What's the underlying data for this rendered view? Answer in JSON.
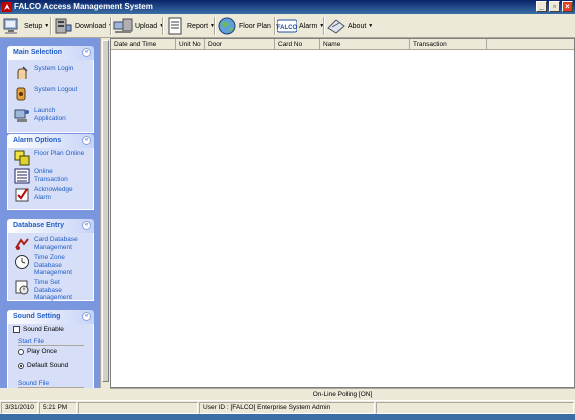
{
  "window": {
    "title": "FALCO  Access Management System"
  },
  "toolbar": {
    "items": [
      {
        "label": "Setup",
        "icon": "computer-icon"
      },
      {
        "label": "Download",
        "icon": "server-icon"
      },
      {
        "label": "Upload",
        "icon": "computers-icon"
      },
      {
        "label": "Report",
        "icon": "report-icon"
      },
      {
        "label": "Floor Plan",
        "icon": "globe-icon"
      },
      {
        "label": "Alarm",
        "icon": "falco-logo-icon",
        "logo_text": "FALCO"
      },
      {
        "label": "About",
        "icon": "about-icon"
      }
    ]
  },
  "sidebar": {
    "main": {
      "title": "Main Selection",
      "items": [
        {
          "label": "System Login",
          "icon": "login-icon"
        },
        {
          "label": "System Logout",
          "icon": "logout-icon"
        },
        {
          "label": "Launch Application",
          "icon": "launch-icon"
        }
      ]
    },
    "alarm": {
      "title": "Alarm Options",
      "items": [
        {
          "label": "Floor Plan Online",
          "icon": "floorplan-icon"
        },
        {
          "label": "Online Transaction",
          "icon": "transaction-list-icon"
        },
        {
          "label": "Acknowledge Alarm",
          "icon": "acknowledge-icon"
        }
      ]
    },
    "database": {
      "title": "Database Entry",
      "items": [
        {
          "label": "Card Database Management",
          "icon": "card-db-icon"
        },
        {
          "label": "Time Zone Database Management",
          "icon": "clock-icon"
        },
        {
          "label": "Time Set Database Management",
          "icon": "timeset-icon"
        }
      ]
    },
    "sound": {
      "title": "Sound Setting",
      "sound_enable": "Sound Enable",
      "sound_enable_checked": false,
      "start_file": "Start File",
      "options": [
        "Play Once",
        "Default Sound"
      ],
      "selected": "Default Sound",
      "sound_file": "Sound File"
    }
  },
  "grid": {
    "columns": [
      "Date and Time",
      "Unit No",
      "Door",
      "Card No",
      "Name",
      "Transaction"
    ]
  },
  "status": {
    "polling": "On-Line Polling [ON]",
    "date": "3/31/2010",
    "time": "5:21 PM",
    "user": "User ID : [FALCO] Enterprise System Admin"
  },
  "colors": {
    "title_bar": "#0a246a",
    "sidebar_bg": "#7a96df",
    "group_header_text": "#215dc6"
  }
}
